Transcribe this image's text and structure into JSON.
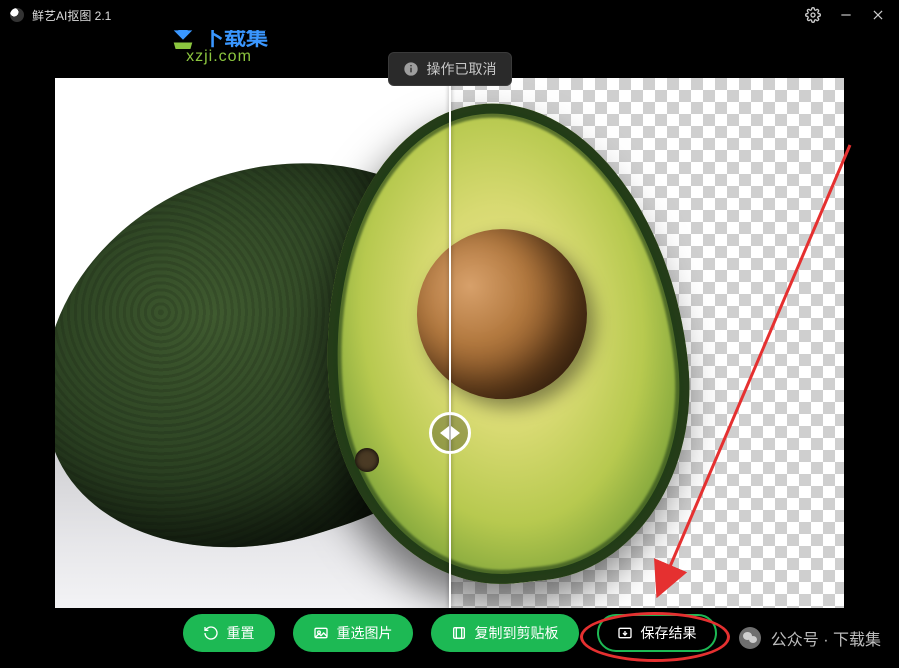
{
  "app": {
    "title": "鲜艺AI抠图 2.1"
  },
  "toast": {
    "text": "操作已取消"
  },
  "watermark": {
    "logo_cn": "下载集",
    "logo_en": "xzji.com",
    "footer": "公众号 · 下载集"
  },
  "buttons": {
    "reset": "重置",
    "reselect": "重选图片",
    "copy": "复制到剪贴板",
    "save": "保存结果"
  },
  "icons": {
    "settings": "gear-icon",
    "minimize": "minimize-icon",
    "close": "close-icon",
    "info": "info-icon",
    "reset": "refresh-icon",
    "reselect": "image-swap-icon",
    "copy": "clipboard-icon",
    "save": "image-save-icon",
    "slider": "compare-slider-icon",
    "download": "download-arrow-icon",
    "wechat": "wechat-icon"
  },
  "annotation": {
    "arrow_target": "save-result-button",
    "circle_target": "save-result-button",
    "color": "#e53030"
  },
  "colors": {
    "accent": "#1db954",
    "brand_blue": "#3a97ff",
    "brand_green": "#8cc63f"
  }
}
